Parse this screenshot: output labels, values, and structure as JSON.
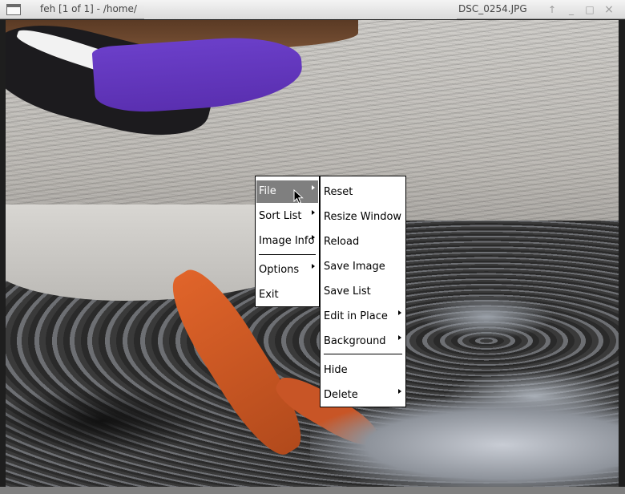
{
  "window": {
    "title_left": "feh [1 of 1] - /home/",
    "title_right": "DSC_0254.JPG",
    "controls": {
      "up_glyph": "↑",
      "minimize_glyph": "_",
      "maximize_glyph": "□",
      "close_glyph": "×"
    }
  },
  "main_menu": {
    "items": [
      {
        "label": "File",
        "has_submenu": true,
        "active": true
      },
      {
        "label": "Sort List",
        "has_submenu": true
      },
      {
        "label": "Image Info",
        "has_submenu": true
      },
      {
        "label": "Options",
        "has_submenu": true
      },
      {
        "label": "Exit",
        "has_submenu": false
      }
    ]
  },
  "file_submenu": {
    "items": [
      {
        "label": "Reset",
        "has_submenu": false
      },
      {
        "label": "Resize Window",
        "has_submenu": false
      },
      {
        "label": "Reload",
        "has_submenu": false
      },
      {
        "label": "Save Image",
        "has_submenu": false
      },
      {
        "label": "Save List",
        "has_submenu": false
      },
      {
        "label": "Edit in Place",
        "has_submenu": true
      },
      {
        "label": "Background",
        "has_submenu": true
      },
      {
        "label": "Hide",
        "has_submenu": false
      },
      {
        "label": "Delete",
        "has_submenu": true
      }
    ]
  },
  "colors": {
    "menu_highlight": "#7f7f7f",
    "menu_bg": "#ffffff"
  }
}
